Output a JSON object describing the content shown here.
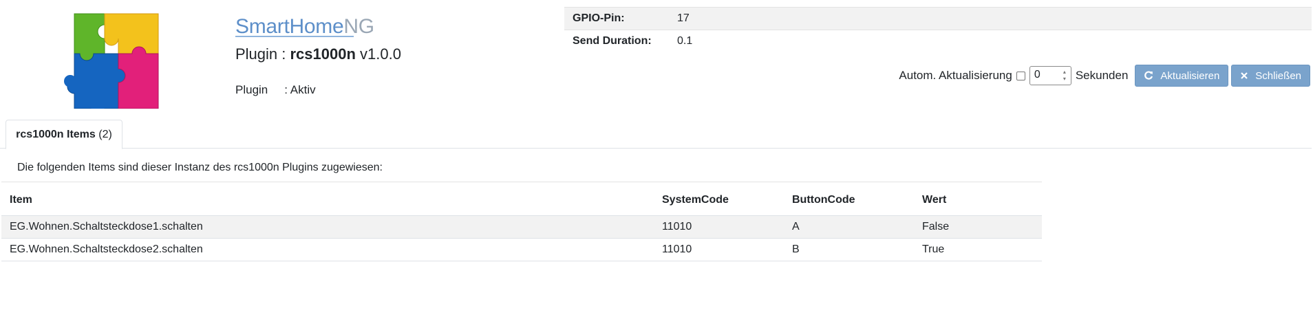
{
  "brand": {
    "main": "SmartHome",
    "suffix": "NG"
  },
  "plugin": {
    "title_prefix": "Plugin : ",
    "name": "rcs1000n",
    "version": "v1.0.0",
    "status_label": "Plugin",
    "status_value": ": Aktiv"
  },
  "info": [
    {
      "label": "GPIO-Pin:",
      "value": "17"
    },
    {
      "label": "Send Duration:",
      "value": "0.1"
    }
  ],
  "controls": {
    "auto_refresh_label": "Autom. Aktualisierung",
    "auto_refresh_checked": false,
    "interval_value": "0",
    "unit_label": "Sekunden",
    "refresh_button": "Aktualisieren",
    "close_button": "Schließen"
  },
  "tab": {
    "name": "rcs1000n Items",
    "count": "(2)"
  },
  "description": "Die folgenden Items sind dieser Instanz des rcs1000n Plugins zugewiesen:",
  "table": {
    "headers": [
      "Item",
      "SystemCode",
      "ButtonCode",
      "Wert"
    ],
    "rows": [
      [
        "EG.Wohnen.Schaltsteckdose1.schalten",
        "11010",
        "A",
        "False"
      ],
      [
        "EG.Wohnen.Schaltsteckdose2.schalten",
        "11010",
        "B",
        "True"
      ]
    ]
  },
  "colors": {
    "button": "#7aa3cc",
    "brand": "#5d8fc9",
    "row_stripe": "#f2f2f2"
  }
}
